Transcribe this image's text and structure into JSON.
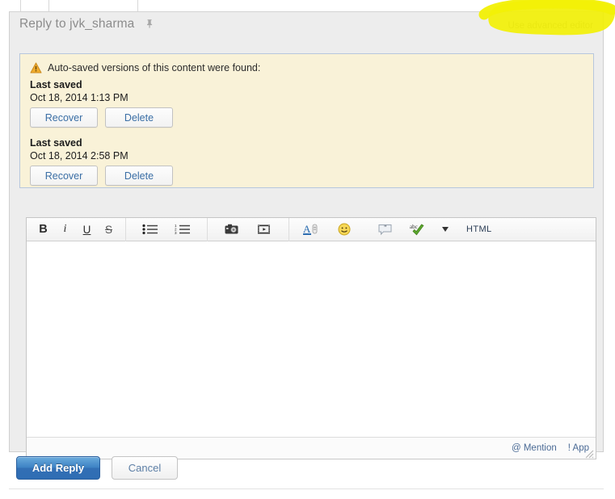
{
  "header": {
    "title": "Reply to jvk_sharma",
    "pin_icon": "pin-icon",
    "advanced_editor_link": "Use advanced editor",
    "highlight_color": "#f2f006"
  },
  "autosave": {
    "icon": "warning-triangle-icon",
    "headline": "Auto-saved versions of this content were found:",
    "background": "#f9f2d8",
    "border": "#b7c7dd",
    "entries": [
      {
        "label": "Last saved",
        "time": "Oct 18, 2014 1:13 PM",
        "recover_label": "Recover",
        "delete_label": "Delete"
      },
      {
        "label": "Last saved",
        "time": "Oct 18, 2014 2:58 PM",
        "recover_label": "Recover",
        "delete_label": "Delete"
      }
    ]
  },
  "editor": {
    "toolbar": {
      "groups": [
        {
          "name": "text-format",
          "buttons": [
            {
              "name": "bold-button",
              "glyph": "B",
              "title": "Bold"
            },
            {
              "name": "italic-button",
              "glyph": "i",
              "title": "Italic"
            },
            {
              "name": "underline-button",
              "glyph": "U",
              "title": "Underline"
            },
            {
              "name": "strikethrough-button",
              "glyph": "S",
              "title": "Strikethrough"
            }
          ]
        },
        {
          "name": "lists",
          "buttons": [
            {
              "name": "bullet-list-button",
              "glyph": "",
              "title": "Bulleted list"
            },
            {
              "name": "numbered-list-button",
              "glyph": "",
              "title": "Numbered list"
            }
          ]
        },
        {
          "name": "media",
          "buttons": [
            {
              "name": "insert-image-button",
              "glyph": "",
              "title": "Insert image"
            },
            {
              "name": "insert-video-button",
              "glyph": "",
              "title": "Insert video"
            }
          ]
        },
        {
          "name": "extras",
          "buttons": [
            {
              "name": "font-color-button",
              "glyph": "A",
              "title": "Font color"
            },
            {
              "name": "emoticon-button",
              "glyph": "",
              "title": "Insert emoticon"
            },
            {
              "name": "quote-button",
              "glyph": "",
              "title": "Quote"
            },
            {
              "name": "spellcheck-button",
              "glyph": "abc",
              "title": "Spell check"
            }
          ]
        }
      ],
      "html_label": "HTML"
    },
    "body_value": "",
    "body_placeholder": "",
    "footer": {
      "mention_label": "@ Mention",
      "app_label": "! App",
      "resize_grip": "resize-grip-icon"
    }
  },
  "actions": {
    "submit_label": "Add Reply",
    "cancel_label": "Cancel",
    "submit_color": "#3d82c4"
  }
}
